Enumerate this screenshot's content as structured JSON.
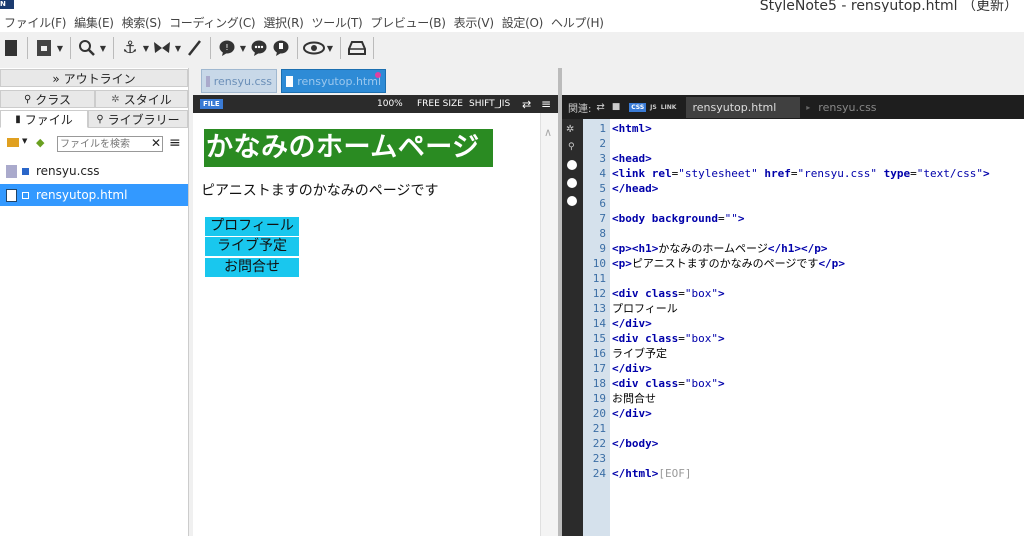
{
  "app": {
    "logo": "N",
    "title": "StyleNote5 - rensyutop.html （更新）"
  },
  "menu": [
    "ファイル(F)",
    "編集(E)",
    "検索(S)",
    "コーディング(C)",
    "選択(R)",
    "ツール(T)",
    "プレビュー(B)",
    "表示(V)",
    "設定(O)",
    "ヘルプ(H)"
  ],
  "toolbar_icons": [
    "new-file-icon",
    "open-file-icon",
    "search-icon",
    "anchor-icon",
    "butterfly-icon",
    "brush-icon",
    "comment-icon",
    "chat-icon",
    "chat-alt-icon",
    "eye-icon",
    "inbox-icon"
  ],
  "left_panel": {
    "outline_tab": "» アウトライン",
    "class_tab": "クラス",
    "style_tab": "スタイル",
    "file_tab": "ファイル",
    "library_tab": "ライブラリー",
    "search_placeholder": "ファイルを検索",
    "files": [
      {
        "name": "rensyu.css",
        "selected": false
      },
      {
        "name": "rensyutop.html",
        "selected": true
      }
    ]
  },
  "file_tabs": [
    "rensyu.css",
    "rensyutop.html"
  ],
  "preview_bar": {
    "badge": "FILE",
    "zoom": "100%",
    "size": "FREE SIZE",
    "encoding": "SHIFT_JIS"
  },
  "preview": {
    "heading": "かなみのホームページ",
    "paragraph": "ピアニストますのかなみのページです",
    "boxes": [
      "プロフィール",
      "ライブ予定",
      "お問合せ"
    ]
  },
  "code_panel": {
    "related_label": "関連:",
    "css_badge": "CSS",
    "js_badge": "JS",
    "link_badge": "LINK",
    "active_tab": "rensyutop.html",
    "inactive_tab": "rensyu.css",
    "lines": [
      "<html>",
      "",
      "<head>",
      "<link rel=\"stylesheet\" href=\"rensyu.css\" type=\"text/css\">",
      "</head>",
      "",
      "<body background=\"\">",
      "",
      "<p><h1>かなみのホームページ</h1></p>",
      "<p>ピアニストますのかなみのページです</p>",
      "",
      "<div class=\"box\">",
      "プロフィール",
      "</div>",
      "<div class=\"box\">",
      "ライブ予定",
      "</div>",
      "<div class=\"box\">",
      "お問合せ",
      "</div>",
      "",
      "</body>",
      "",
      "</html>"
    ],
    "eof": "[EOF]"
  },
  "colors": {
    "heading_bg": "#2a8b22",
    "box_bg": "#19c7ee",
    "selection": "#3399ff",
    "code_tag": "#0000aa"
  }
}
